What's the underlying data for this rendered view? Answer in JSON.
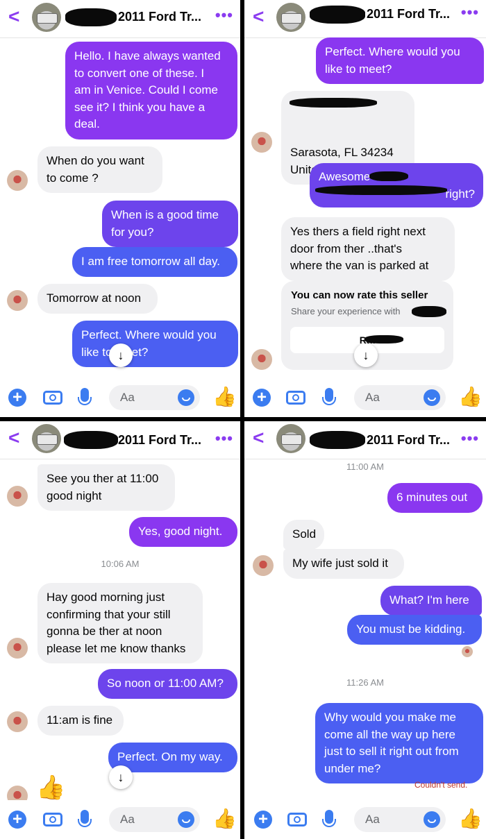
{
  "chat_title": "2011 Ford Tr...",
  "more_label": "•••",
  "back_label": "<",
  "composer": {
    "placeholder": "Aa",
    "plus": "+",
    "like": "👍"
  },
  "scroll_down": "↓",
  "colors": {
    "accent": "#8b3cf0",
    "bubble_violet": "#8a37f0",
    "bubble_blue": "#4b5ff2",
    "received": "#f0f0f2"
  },
  "icons": [
    "back-chevron-icon",
    "more-icon",
    "plus-icon",
    "camera-icon",
    "mic-icon",
    "emoji-icon",
    "thumbs-up-icon",
    "scroll-down-icon"
  ],
  "panel1": {
    "messages": [
      {
        "text": "Hello. I have always wanted\nto convert one of these. I\nam in Venice. Could I come\nsee it? I think you have a\ndeal."
      },
      {
        "text": "When do you want\nto come ?"
      },
      {
        "text": "When is a good time\nfor you?"
      },
      {
        "text": "I am free tomorrow all day."
      },
      {
        "text": "Tomorrow at noon"
      },
      {
        "text": "Perfect. Where would you\nlike to meet?"
      }
    ]
  },
  "panel2": {
    "messages": [
      {
        "text": "Perfect. Where would you\nlike to meet?"
      },
      {
        "text": "Sarasota, FL  34234\nUnited States"
      },
      {
        "text": "Awesome"
      },
      {
        "text": "right?"
      },
      {
        "text": "Yes thers a field right next\ndoor from ther ..that's\nwhere the van is parked at"
      }
    ],
    "rate_card": {
      "title": "You can now rate this seller",
      "subtitle": "Share your experience with",
      "button": "Rat"
    }
  },
  "panel3": {
    "messages": [
      {
        "text": "See you ther at 11:00\ngood night"
      },
      {
        "text": "Yes, good night."
      },
      {
        "text": "Hay good morning just\nconfirming that your still\ngonna be ther at noon\nplease let me know thanks"
      },
      {
        "text": "So noon or 11:00 AM?"
      },
      {
        "text": "11:am is fine"
      },
      {
        "text": "Perfect. On my way."
      }
    ],
    "timestamp": "10:06 AM"
  },
  "panel4": {
    "timestamp_top": "11:00 AM",
    "messages": [
      {
        "text": "6 minutes out"
      },
      {
        "text": "Sold"
      },
      {
        "text": "My wife just sold it"
      },
      {
        "text": "What? I'm here"
      },
      {
        "text": "You must be kidding."
      },
      {
        "text": "Why would you make me\ncome all the way up here\njust to sell it right out from\nunder me?"
      }
    ],
    "timestamp_2": "11:26 AM",
    "error": "Couldn't send."
  }
}
